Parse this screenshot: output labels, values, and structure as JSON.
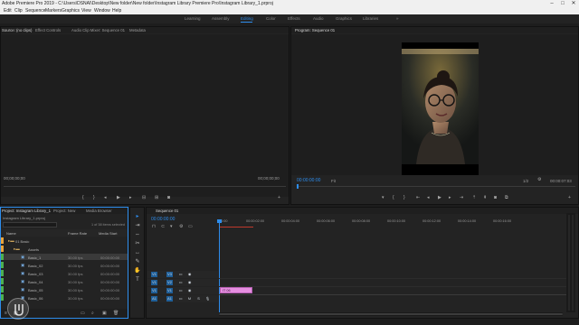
{
  "window": {
    "title": "Adobe Premiere Pro 2019 - C:\\Users\\DSNAI\\Desktop\\New folder\\New folder\\Instagram Library Premiere Pro\\Instagram Library_1.prproj",
    "minimize": "–",
    "maximize": "□",
    "close": "✕"
  },
  "menu": [
    "Edit",
    "Clip",
    "Sequence",
    "Markers",
    "Graphics",
    "View",
    "Window",
    "Help"
  ],
  "workspaces": [
    "Learning",
    "Assembly",
    "Editing",
    "Color",
    "Effects",
    "Audio",
    "Graphics",
    "Libraries"
  ],
  "workspaces_more": "»",
  "source_panel": {
    "tabs": [
      "Source: (no clips)",
      "Effect Controls",
      "Audio Clip Mixer: Sequence 01",
      "Metadata"
    ],
    "timecode_left": "00;00;00;00",
    "timecode_right": "00;00;00;00"
  },
  "program_panel": {
    "title": "Program: Sequence 01",
    "timecode": "00:00:00:00",
    "fit": "Fit",
    "fraction": "1/2",
    "duration": "00:00:07:03"
  },
  "project_panel": {
    "tabs": [
      "Project: Instagram Library_1",
      "Project: New",
      "Media Browser"
    ],
    "file": "Instagram Library_1.prproj",
    "selection_info": "1 of 38 items selected",
    "columns": {
      "name": "Name",
      "frame_rate": "Frame Rate",
      "media_start": "Media Start"
    },
    "rows": [
      {
        "label": "01 Basic",
        "color": "#e8a33b",
        "frame_rate": "",
        "media_start": ""
      },
      {
        "label": "Assets",
        "color": "#e8a33b",
        "frame_rate": "",
        "media_start": ""
      },
      {
        "label": "Basic_1",
        "color": "#4caf50",
        "frame_rate": "30.00 fps",
        "media_start": "00:00:00:00",
        "selected": true
      },
      {
        "label": "Basic_02",
        "color": "#4caf50",
        "frame_rate": "30.00 fps",
        "media_start": "00:00:00:00"
      },
      {
        "label": "Basic_03",
        "color": "#4caf50",
        "frame_rate": "30.00 fps",
        "media_start": "00:00:00:00"
      },
      {
        "label": "Basic_04",
        "color": "#4caf50",
        "frame_rate": "30.00 fps",
        "media_start": "00:00:00:00"
      },
      {
        "label": "Basic_05",
        "color": "#4caf50",
        "frame_rate": "30.00 fps",
        "media_start": "00:00:00:00"
      },
      {
        "label": "Basic_06",
        "color": "#4caf50",
        "frame_rate": "30.00 fps",
        "media_start": "00:00:00:00"
      }
    ]
  },
  "timeline": {
    "tab": "Sequence 01",
    "timecode": "00:00:00:00",
    "ruler": [
      "00:00",
      "00:00:02:00",
      "00:00:04:00",
      "00:00:06:00",
      "00:00:08:00",
      "00:00:10:00",
      "00:00:12:00",
      "00:00:14:00",
      "00:00:16:00"
    ],
    "tracks": [
      {
        "src": "V1",
        "name": "V3"
      },
      {
        "src": "V1",
        "name": "V2"
      },
      {
        "src": "V1",
        "name": "V1"
      },
      {
        "src": "A1",
        "name": "A1"
      }
    ],
    "clip_label": "IT 06"
  },
  "colors": {
    "accent": "#2d8ceb",
    "clip": "#e58ee0",
    "label_orange": "#e8a33b",
    "label_green": "#4caf50"
  }
}
